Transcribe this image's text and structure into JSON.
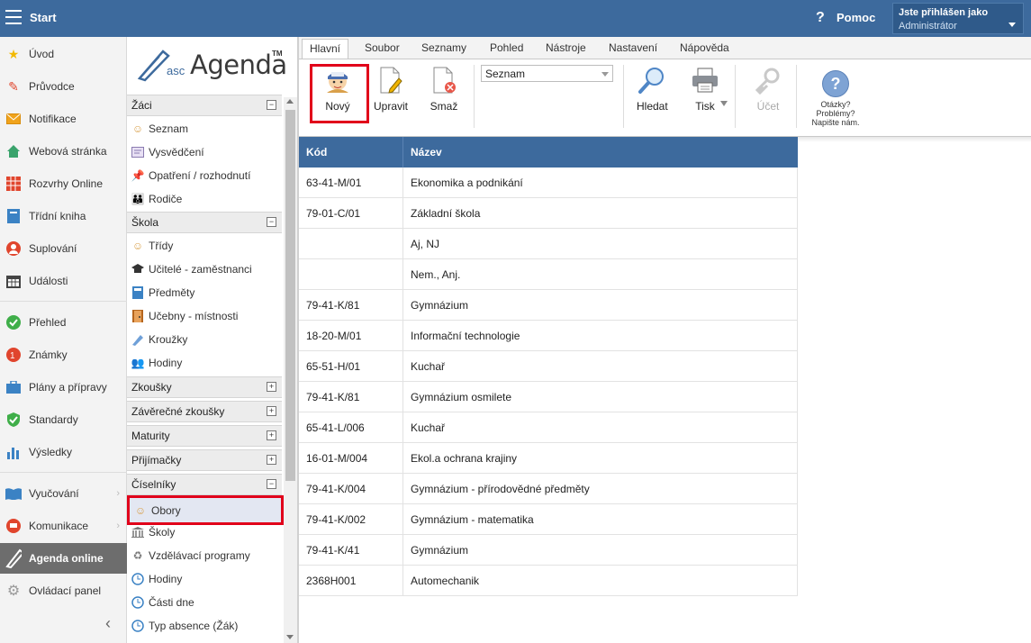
{
  "topbar": {
    "title": "Start",
    "help_label": "Pomoc",
    "user_line1": "Jste přihlášen jako",
    "user_line2": "Administrátor"
  },
  "leftnav": {
    "items": [
      {
        "label": "Úvod",
        "icon": "star-icon",
        "color": "#f2b900"
      },
      {
        "label": "Průvodce",
        "icon": "wand-icon",
        "color": "#e0452d"
      },
      {
        "label": "Notifikace",
        "icon": "envelope-icon",
        "color": "#f0a31c"
      },
      {
        "label": "Webová stránka",
        "icon": "home-icon",
        "color": "#3aa36c"
      },
      {
        "label": "Rozvrhy Online",
        "icon": "calendar-grid-icon",
        "color": "#e0452d"
      },
      {
        "label": "Třídní kniha",
        "icon": "book-icon",
        "color": "#3b82c4"
      },
      {
        "label": "Suplování",
        "icon": "person-icon",
        "color": "#e0452d"
      },
      {
        "label": "Události",
        "icon": "calendar-icon",
        "color": "#444444"
      },
      {
        "label": "Přehled",
        "icon": "check-circle-icon",
        "color": "#3fae49"
      },
      {
        "label": "Známky",
        "icon": "grade-icon",
        "color": "#e0452d"
      },
      {
        "label": "Plány a přípravy",
        "icon": "briefcase-icon",
        "color": "#3b82c4"
      },
      {
        "label": "Standardy",
        "icon": "shield-check-icon",
        "color": "#3fae49"
      },
      {
        "label": "Výsledky",
        "icon": "bar-chart-icon",
        "color": "#3b82c4"
      },
      {
        "label": "Vyučování",
        "icon": "open-book-icon",
        "color": "#3b82c4"
      },
      {
        "label": "Komunikace",
        "icon": "chat-icon",
        "color": "#e0452d"
      },
      {
        "label": "Agenda online",
        "icon": "pen-icon",
        "color": "#ffffff"
      },
      {
        "label": "Ovládací panel",
        "icon": "gear-icon",
        "color": "#999999"
      }
    ]
  },
  "subnav": {
    "logo_asc": "asc",
    "logo_agenda": "Agenda",
    "logo_tm": "TM",
    "sections": {
      "zaci": "Žáci",
      "skola": "Škola",
      "zkousky": "Zkoušky",
      "zaverecne": "Závěrečné zkoušky",
      "maturity": "Maturity",
      "prijimacky": "Přijímačky",
      "ciselniky": "Číselníky"
    },
    "zaci_items": [
      "Seznam",
      "Vysvědčení",
      "Opatření / rozhodnutí",
      "Rodiče"
    ],
    "skola_items": [
      "Třídy",
      "Učitelé - zaměstnanci",
      "Předměty",
      "Učebny - místnosti",
      "Kroužky",
      "Hodiny"
    ],
    "ciselniky_items": [
      "Obory",
      "Školy",
      "Vzdělávací programy",
      "Hodiny",
      "Části dne",
      "Typ absence (Žák)"
    ]
  },
  "ribbon": {
    "tabs": [
      "Hlavní",
      "Soubor",
      "Seznamy",
      "Pohled",
      "Nástroje",
      "Nastavení",
      "Nápověda"
    ],
    "buttons": {
      "novy": "Nový",
      "upravit": "Upravit",
      "smaz": "Smaž",
      "hledat": "Hledat",
      "tisk": "Tisk",
      "ucet": "Účet"
    },
    "view_select": "Seznam",
    "help_text_1": "Otázky?",
    "help_text_2": "Problémy?",
    "help_text_3": "Napište nám."
  },
  "table": {
    "columns": [
      "Kód",
      "Název"
    ],
    "rows": [
      [
        "63-41-M/01",
        "Ekonomika a podnikání"
      ],
      [
        "79-01-C/01",
        "Základní škola"
      ],
      [
        "",
        "Aj, NJ"
      ],
      [
        "",
        "Nem., Anj."
      ],
      [
        "79-41-K/81",
        "Gymnázium"
      ],
      [
        "18-20-M/01",
        "Informační technologie"
      ],
      [
        "65-51-H/01",
        "Kuchař"
      ],
      [
        "79-41-K/81",
        "Gymnázium osmilete"
      ],
      [
        "65-41-L/006",
        "Kuchař"
      ],
      [
        "16-01-M/004",
        "Ekol.a ochrana krajiny"
      ],
      [
        "79-41-K/004",
        "Gymnázium - přírodovědné předměty"
      ],
      [
        "79-41-K/002",
        "Gymnázium - matematika"
      ],
      [
        "79-41-K/41",
        "Gymnázium"
      ],
      [
        "2368H001",
        "Automechanik"
      ]
    ]
  }
}
